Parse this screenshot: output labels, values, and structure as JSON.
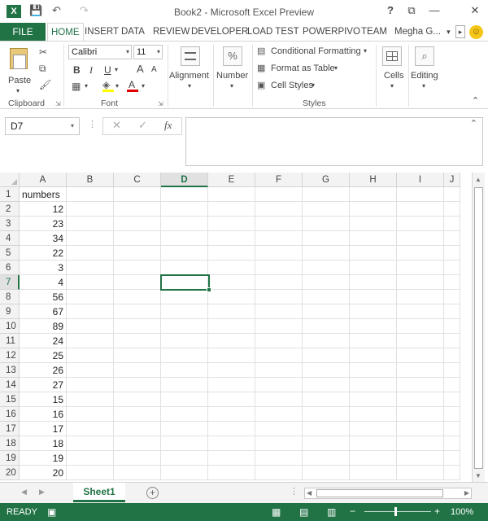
{
  "window": {
    "title": "Book2 - Microsoft Excel Preview",
    "help": "?",
    "restore": "⧉",
    "minimize": "—",
    "close": "✕"
  },
  "qat": {
    "save": "💾",
    "undo": "↶",
    "redo": "↷"
  },
  "tabs": {
    "file": "FILE",
    "items": [
      "HOME",
      "INSERT",
      "DATA",
      "REVIEW",
      "DEVELOPER",
      "LOAD TEST",
      "POWERPIVO",
      "TEAM"
    ],
    "user": "Megha G...",
    "user_arrow": "▾",
    "scroll": "▸"
  },
  "ribbon": {
    "clipboard": {
      "paste": "Paste",
      "label": "Clipboard"
    },
    "font": {
      "name": "Calibri",
      "size": "11",
      "bold": "B",
      "italic": "I",
      "underline": "U",
      "grow": "A",
      "shrink": "A",
      "label": "Font"
    },
    "alignment": {
      "label": "Alignment"
    },
    "number": {
      "label": "Number",
      "symbol": "%"
    },
    "styles": {
      "conditional": "Conditional Formatting",
      "format_table": "Format as Table",
      "cell_styles": "Cell Styles",
      "label": "Styles"
    },
    "cells": {
      "label": "Cells"
    },
    "editing": {
      "label": "Editing"
    },
    "collapse": "⌃"
  },
  "formula_bar": {
    "name_box": "D7",
    "cancel": "✕",
    "enter": "✓",
    "fx": "fx",
    "value": ""
  },
  "grid": {
    "columns": [
      "A",
      "B",
      "C",
      "D",
      "E",
      "F",
      "G",
      "H",
      "I",
      "J"
    ],
    "selected_column": "D",
    "selected_row": 7,
    "rows": [
      {
        "n": "1",
        "a": "numbers"
      },
      {
        "n": "2",
        "a": "12"
      },
      {
        "n": "3",
        "a": "23"
      },
      {
        "n": "4",
        "a": "34"
      },
      {
        "n": "5",
        "a": "22"
      },
      {
        "n": "6",
        "a": "3"
      },
      {
        "n": "7",
        "a": "4"
      },
      {
        "n": "8",
        "a": "56"
      },
      {
        "n": "9",
        "a": "67"
      },
      {
        "n": "10",
        "a": "89"
      },
      {
        "n": "11",
        "a": "24"
      },
      {
        "n": "12",
        "a": "25"
      },
      {
        "n": "13",
        "a": "26"
      },
      {
        "n": "14",
        "a": "27"
      },
      {
        "n": "15",
        "a": "15"
      },
      {
        "n": "16",
        "a": "16"
      },
      {
        "n": "17",
        "a": "17"
      },
      {
        "n": "18",
        "a": "18"
      },
      {
        "n": "19",
        "a": "19"
      },
      {
        "n": "20",
        "a": "20"
      }
    ]
  },
  "sheets": {
    "active": "Sheet1",
    "add": "+"
  },
  "status": {
    "text": "READY",
    "zoom": "100%",
    "zoom_minus": "−",
    "zoom_plus": "+"
  },
  "colors": {
    "accent": "#217346"
  }
}
